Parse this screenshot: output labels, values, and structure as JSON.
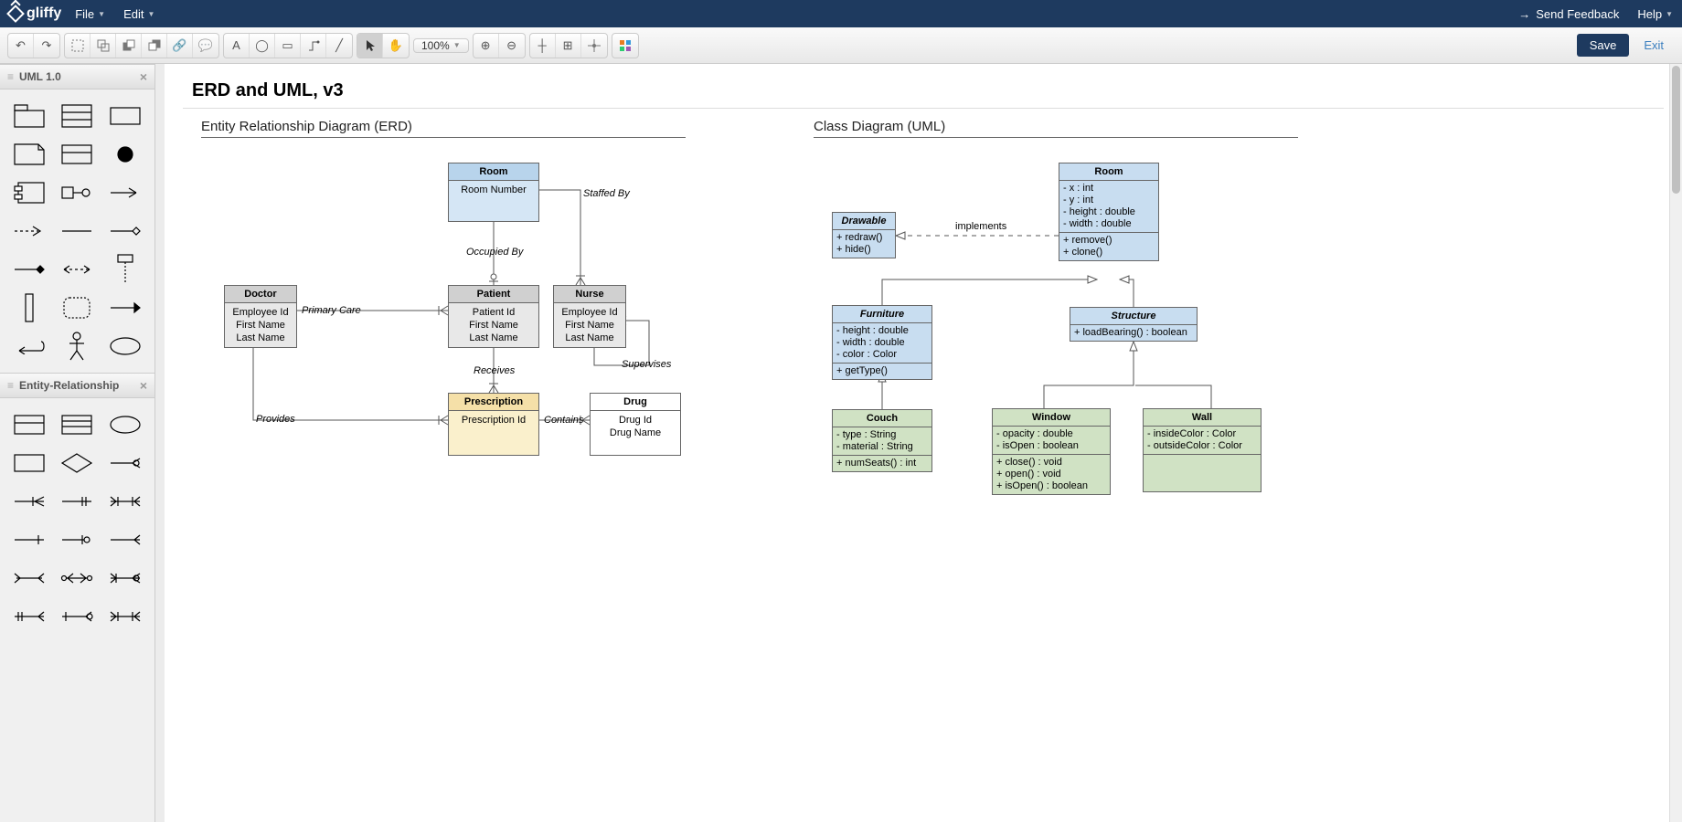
{
  "app": {
    "name": "gliffy"
  },
  "menu": {
    "file": "File",
    "edit": "Edit"
  },
  "topright": {
    "feedback": "Send Feedback",
    "help": "Help"
  },
  "toolbar": {
    "zoom": "100%",
    "save": "Save",
    "exit": "Exit"
  },
  "sidebar": {
    "panel1": "UML 1.0",
    "panel2": "Entity-Relationship"
  },
  "doc": {
    "title": "ERD and UML, v3"
  },
  "erd": {
    "title": "Entity Relationship Diagram (ERD)",
    "room": {
      "name": "Room",
      "attrs": [
        "Room Number"
      ]
    },
    "doctor": {
      "name": "Doctor",
      "attrs": [
        "Employee Id",
        "First Name",
        "Last Name"
      ]
    },
    "patient": {
      "name": "Patient",
      "attrs": [
        "Patient Id",
        "First Name",
        "Last Name"
      ]
    },
    "nurse": {
      "name": "Nurse",
      "attrs": [
        "Employee Id",
        "First Name",
        "Last Name"
      ]
    },
    "prescription": {
      "name": "Prescription",
      "attrs": [
        "Prescription Id"
      ]
    },
    "drug": {
      "name": "Drug",
      "attrs": [
        "Drug Id",
        "Drug Name"
      ]
    },
    "labels": {
      "staffedby": "Staffed By",
      "occupiedby": "Occupied By",
      "primarycare": "Primary Care",
      "supervises": "Supervises",
      "receives": "Receives",
      "provides": "Provides",
      "contains": "Contains"
    }
  },
  "uml": {
    "title": "Class Diagram (UML)",
    "implements": "implements",
    "drawable": {
      "name": "Drawable",
      "methods": [
        "+ redraw()",
        "+ hide()"
      ]
    },
    "room": {
      "name": "Room",
      "attrs": [
        "- x : int",
        "- y : int",
        "- height : double",
        "- width : double"
      ],
      "methods": [
        "+ remove()",
        "+ clone()"
      ]
    },
    "furniture": {
      "name": "Furniture",
      "attrs": [
        "- height : double",
        "- width : double",
        "- color : Color"
      ],
      "methods": [
        "+ getType()"
      ]
    },
    "structure": {
      "name": "Structure",
      "methods": [
        "+ loadBearing() : boolean"
      ]
    },
    "couch": {
      "name": "Couch",
      "attrs": [
        "- type : String",
        "- material : String"
      ],
      "methods": [
        "+ numSeats() : int"
      ]
    },
    "window": {
      "name": "Window",
      "attrs": [
        "- opacity : double",
        "- isOpen : boolean"
      ],
      "methods": [
        "+ close() : void",
        "+ open() : void",
        "+ isOpen() : boolean"
      ]
    },
    "wall": {
      "name": "Wall",
      "attrs": [
        "- insideColor : Color",
        "- outsideColor : Color"
      ]
    }
  }
}
